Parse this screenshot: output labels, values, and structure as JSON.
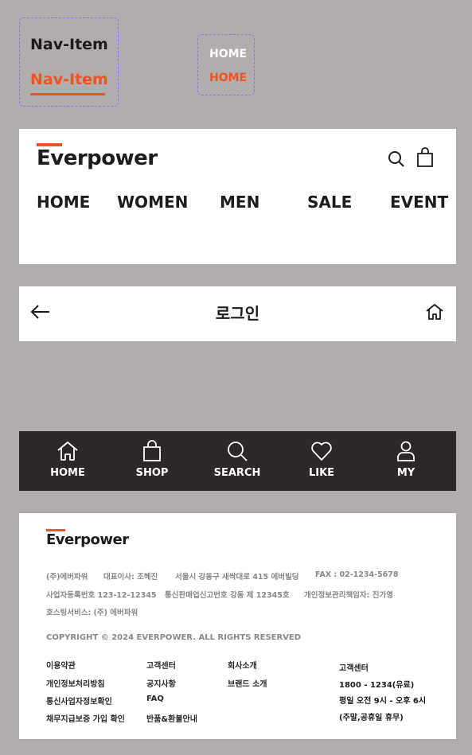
{
  "variants": {
    "nav_default": "Nav-Item",
    "nav_active": "Nav-Item",
    "home_default": "HOME",
    "home_active": "HOME"
  },
  "header": {
    "logo": "Everpower",
    "nav": [
      "HOME",
      "WOMEN",
      "MEN",
      "SALE",
      "EVENT"
    ]
  },
  "login_bar": {
    "title": "로그인"
  },
  "tab_bar": {
    "tabs": [
      {
        "label": "HOME",
        "icon": "home-icon"
      },
      {
        "label": "SHOP",
        "icon": "shopping-bag-icon"
      },
      {
        "label": "SEARCH",
        "icon": "search-icon"
      },
      {
        "label": "LIKE",
        "icon": "heart-icon"
      },
      {
        "label": "MY",
        "icon": "user-icon"
      }
    ]
  },
  "footer": {
    "logo": "Everpower",
    "info": {
      "company": "(주)에버파워",
      "ceo": "대표이사: 조혜진",
      "address": "서울시 강동구 새싹대로 415 에버빌딩",
      "fax": "FAX : 02-1234-5678",
      "biz_no": "사업자등록번호 123-12-12345",
      "ecom_no": "통신판매업신고번호 강동 제 12345호",
      "privacy_officer": "개인정보관리책임자: 진가영",
      "hosting": "호스팅서비스: (주) 에버파워"
    },
    "copyright": "COPYRIGHT © 2024 EVERPOWER. ALL RIGHTS RESERVED",
    "links_col1": [
      "이용약관",
      "개인정보처리방침",
      "통신사업자정보확인",
      "채무지급보증 가입 확인"
    ],
    "links_col2": [
      "고객센터",
      "공지사항",
      "FAQ",
      "반품&환불안내"
    ],
    "links_col3": [
      "회사소개",
      "브랜드 소개"
    ],
    "cs": {
      "title": "고객센터",
      "phone": "1800 - 1234(유료)",
      "hours": "평일 오전 9시 - 오후 6시",
      "holiday": "(주말,공휴일 휴무)"
    }
  },
  "colors": {
    "accent": "#f05423",
    "background": "#b1adac",
    "dark": "#2c2729",
    "variant_border": "#9b6cf0"
  }
}
